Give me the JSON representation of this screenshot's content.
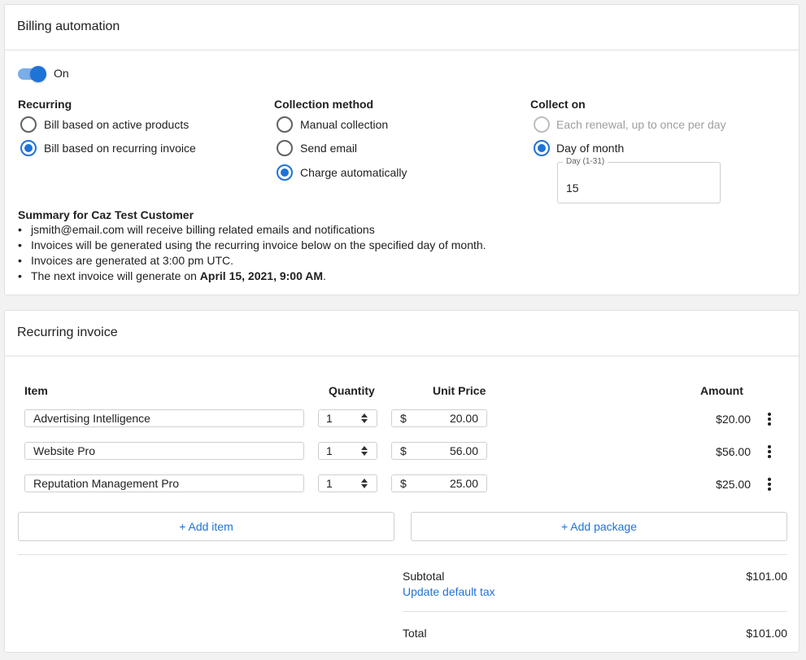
{
  "billing": {
    "title": "Billing automation",
    "toggle_label": "On",
    "recurring": {
      "heading": "Recurring",
      "options": [
        "Bill based on active products",
        "Bill based on recurring invoice"
      ],
      "selected": 1
    },
    "collection": {
      "heading": "Collection method",
      "options": [
        "Manual collection",
        "Send email",
        "Charge automatically"
      ],
      "selected": 2
    },
    "collect_on": {
      "heading": "Collect on",
      "options": [
        "Each renewal, up to once per day",
        "Day of month"
      ],
      "selected": 1,
      "day_label": "Day (1-31)",
      "day_value": "15"
    },
    "summary": {
      "heading": "Summary for Caz Test Customer",
      "items": [
        "jsmith@email.com will receive billing related emails and notifications",
        "Invoices will be generated using the recurring invoice below on the specified day of month.",
        "Invoices are generated at 3:00 pm UTC."
      ],
      "next_prefix": "The next invoice will generate on ",
      "next_date": "April 15, 2021, 9:00 AM",
      "next_suffix": "."
    }
  },
  "invoice": {
    "title": "Recurring invoice",
    "headers": {
      "item": "Item",
      "quantity": "Quantity",
      "unit_price": "Unit Price",
      "amount": "Amount"
    },
    "currency_symbol": "$",
    "rows": [
      {
        "item": "Advertising Intelligence",
        "quantity": "1",
        "unit_price": "20.00",
        "amount": "$20.00"
      },
      {
        "item": "Website Pro",
        "quantity": "1",
        "unit_price": "56.00",
        "amount": "$56.00"
      },
      {
        "item": "Reputation Management Pro",
        "quantity": "1",
        "unit_price": "25.00",
        "amount": "$25.00"
      }
    ],
    "add_item": "+ Add item",
    "add_package": "+ Add package",
    "subtotal_label": "Subtotal",
    "subtotal_value": "$101.00",
    "update_tax": "Update default tax",
    "total_label": "Total",
    "total_value": "$101.00"
  },
  "colors": {
    "accent": "#1e73d6",
    "toggle_track": "#7aaee8",
    "border": "#e0e0e0"
  }
}
